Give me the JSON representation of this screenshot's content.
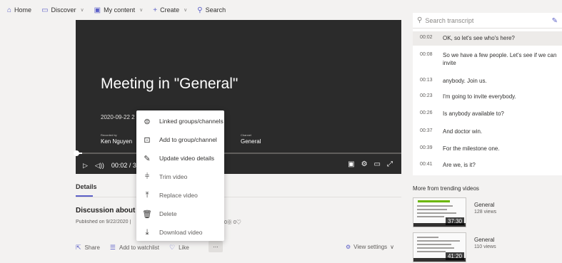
{
  "nav": {
    "home": "Home",
    "discover": "Discover",
    "my_content": "My content",
    "create": "Create",
    "search": "Search"
  },
  "player": {
    "title": "Meeting in \"General\"",
    "date": "2020-09-22 2",
    "recorded_by_label": "Recorded by",
    "recorded_by": "Ken Nguyen",
    "channel_label": "Channel",
    "channel": "General",
    "time": "00:02 / 3",
    "progress": 0.02
  },
  "details": {
    "tab": "Details",
    "title": "Discussion about de",
    "published": "Published on 9/22/2020 |",
    "counts": "0⓪  0♡",
    "actions": {
      "share": "Share",
      "watchlist": "Add to watchlist",
      "like": "Like",
      "more": "…"
    },
    "view_settings": "View settings"
  },
  "menu": {
    "items": [
      {
        "label": "Linked groups/channels",
        "icon": "linked-icon"
      },
      {
        "label": "Add to group/channel",
        "icon": "add-group-icon"
      },
      {
        "label": "Update video details",
        "icon": "pencil-icon"
      },
      {
        "label": "Trim video",
        "icon": "trim-icon"
      },
      {
        "label": "Replace video",
        "icon": "upload-icon"
      },
      {
        "label": "Delete",
        "icon": "trash-icon"
      },
      {
        "label": "Download video",
        "icon": "download-icon"
      }
    ]
  },
  "transcript": {
    "search_placeholder": "Search transcript",
    "lines": [
      {
        "time": "00:02",
        "text": "OK, so let's see who's here?"
      },
      {
        "time": "00:08",
        "text": "So we have a few people. Let's see if we can invite"
      },
      {
        "time": "00:13",
        "text": "anybody. Join us."
      },
      {
        "time": "00:23",
        "text": "I'm going to invite everybody."
      },
      {
        "time": "00:26",
        "text": "Is anybody available to?"
      },
      {
        "time": "00:37",
        "text": "And doctor win."
      },
      {
        "time": "00:39",
        "text": "For the milestone one."
      },
      {
        "time": "00:41",
        "text": "Are we, is it?"
      }
    ]
  },
  "trending": {
    "heading": "More from trending videos",
    "videos": [
      {
        "title": "General",
        "views": "128 views",
        "duration": "37:30"
      },
      {
        "title": "General",
        "views": "110 views",
        "duration": "41:20"
      }
    ]
  },
  "colors": {
    "accent": "#5b5fc7",
    "player_bg": "#2b2b2b",
    "page_bg": "#f3f2f1"
  }
}
